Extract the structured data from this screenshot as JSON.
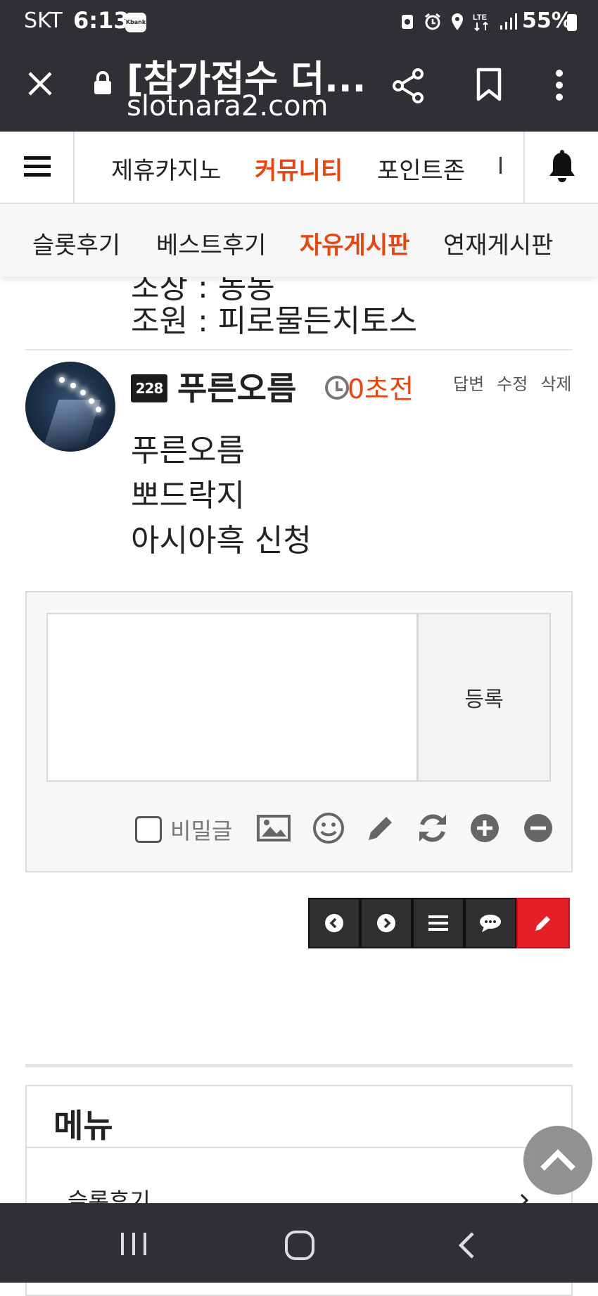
{
  "status_bar": {
    "carrier": "SKT",
    "time": "6:13",
    "app_badge": "Kbank",
    "battery": "55%",
    "network": "LTE"
  },
  "browser": {
    "page_title": "[참가접수 더...",
    "url": "slotnara2.com"
  },
  "site_nav": {
    "items": [
      {
        "label": "제휴카지노",
        "active": false
      },
      {
        "label": "커뮤니티",
        "active": true
      },
      {
        "label": "포인트존",
        "active": false
      }
    ]
  },
  "sub_nav": {
    "items": [
      {
        "label": "슬롯후기",
        "active": false
      },
      {
        "label": "베스트후기",
        "active": false
      },
      {
        "label": "자유게시판",
        "active": true
      },
      {
        "label": "연재게시판",
        "active": false
      }
    ]
  },
  "previous_comment": {
    "cut_line": "조장 : 농농",
    "last_line": "조원 : 피로물든치토스"
  },
  "comment": {
    "level": "228",
    "nickname": "푸른오름",
    "time_ago": "0초전",
    "actions": [
      "답변",
      "수정",
      "삭제"
    ],
    "lines": [
      "푸른오름",
      "뽀드락지",
      "아시아흑 신청"
    ]
  },
  "comment_form": {
    "textarea_placeholder": "",
    "submit_label": "등록",
    "secret_label": "비밀글"
  },
  "menu": {
    "title": "메뉴",
    "first_item": "슬롯후기"
  }
}
